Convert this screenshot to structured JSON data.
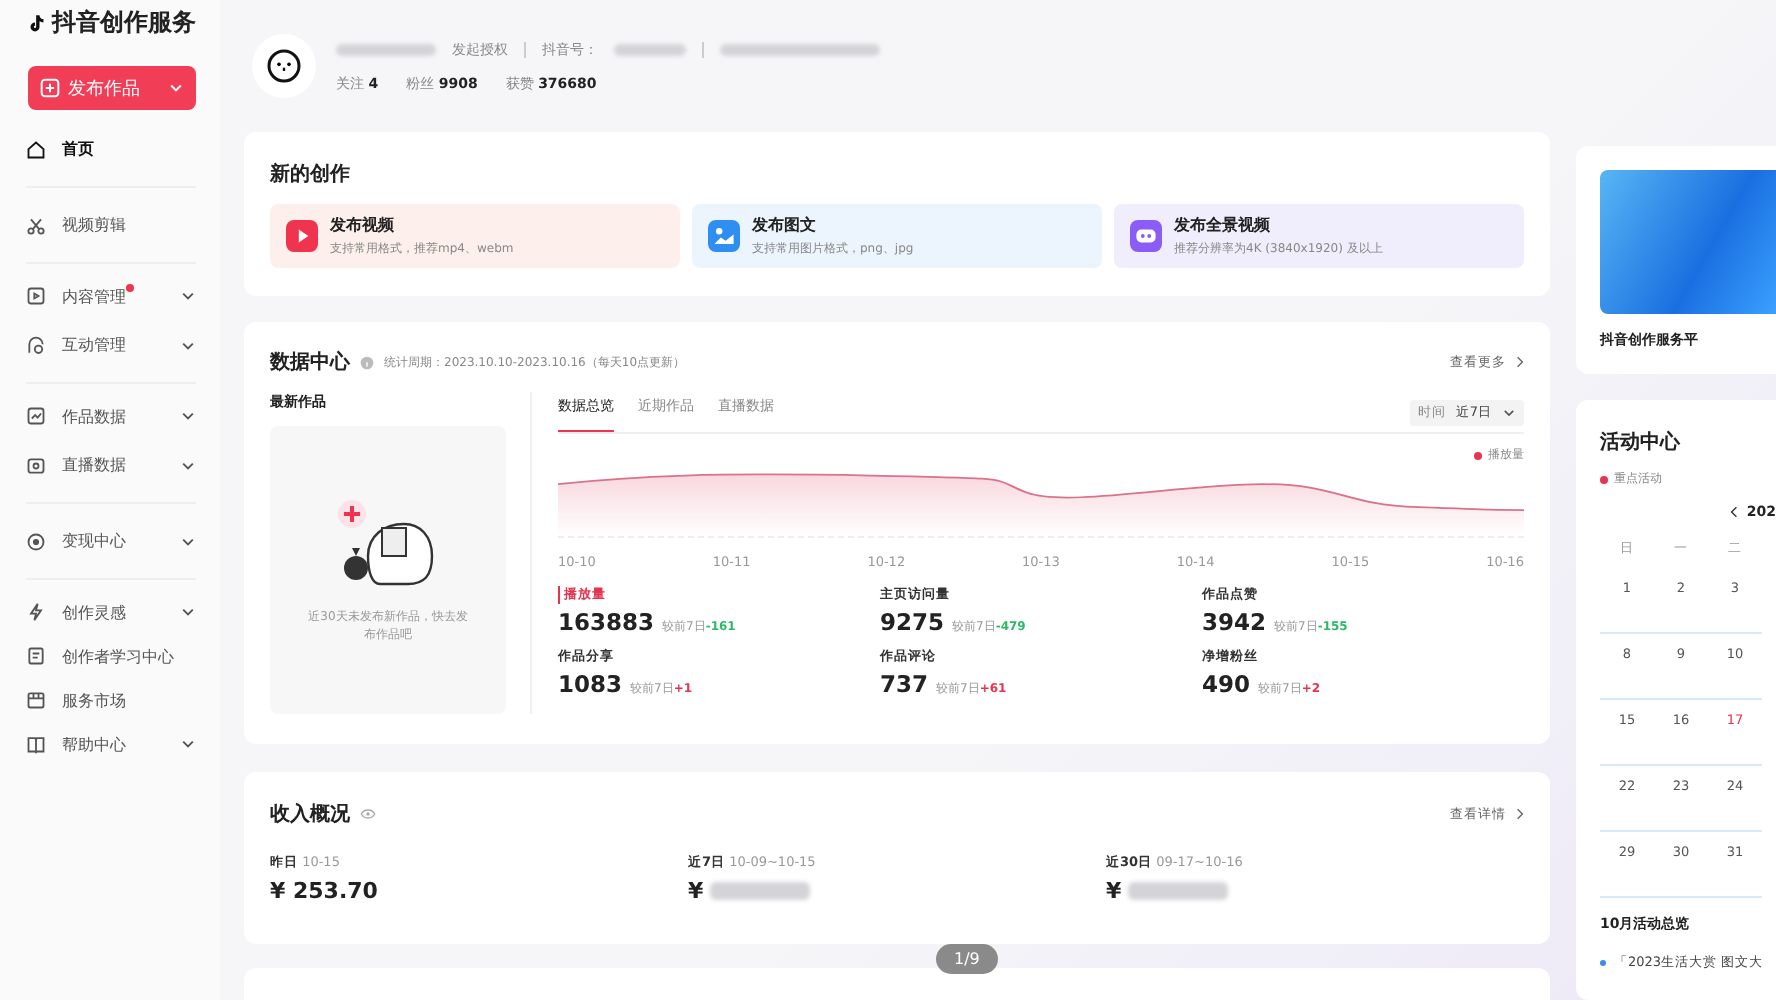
{
  "brand": {
    "name": "抖音创作服务"
  },
  "sidebar": {
    "publish_button": "发布作品",
    "items": [
      {
        "label": "首页",
        "selected": true,
        "expandable": false,
        "dot": false,
        "divider_after": true
      },
      {
        "label": "视频剪辑",
        "selected": false,
        "expandable": false,
        "dot": false,
        "divider_after": true
      },
      {
        "label": "内容管理",
        "selected": false,
        "expandable": true,
        "dot": true,
        "divider_after": false
      },
      {
        "label": "互动管理",
        "selected": false,
        "expandable": true,
        "dot": false,
        "divider_after": true
      },
      {
        "label": "作品数据",
        "selected": false,
        "expandable": true,
        "dot": false,
        "divider_after": false
      },
      {
        "label": "直播数据",
        "selected": false,
        "expandable": true,
        "dot": false,
        "divider_after": true
      },
      {
        "label": "变现中心",
        "selected": false,
        "expandable": true,
        "dot": false,
        "divider_after": true
      },
      {
        "label": "创作灵感",
        "selected": false,
        "expandable": true,
        "dot": false,
        "divider_after": false
      },
      {
        "label": "创作者学习中心",
        "selected": false,
        "expandable": false,
        "dot": false,
        "divider_after": false
      },
      {
        "label": "服务市场",
        "selected": false,
        "expandable": false,
        "dot": false,
        "divider_after": false
      },
      {
        "label": "帮助中心",
        "selected": false,
        "expandable": true,
        "dot": false,
        "divider_after": false
      }
    ]
  },
  "profile": {
    "authorize_link": "发起授权",
    "id_label": "抖音号：",
    "stats": [
      {
        "label": "关注",
        "value": "4"
      },
      {
        "label": "粉丝",
        "value": "9908"
      },
      {
        "label": "获赞",
        "value": "376680"
      }
    ]
  },
  "new_creation": {
    "title": "新的创作",
    "cards": [
      {
        "kind": "video",
        "title": "发布视频",
        "desc": "支持常用格式，推荐mp4、webm"
      },
      {
        "kind": "image",
        "title": "发布图文",
        "desc": "支持常用图片格式，png、jpg"
      },
      {
        "kind": "panorama",
        "title": "发布全景视频",
        "desc": "推荐分辨率为4K (3840x1920) 及以上"
      }
    ]
  },
  "data_center": {
    "title": "数据中心",
    "period": "统计周期：2023.10.10-2023.10.16（每天10点更新）",
    "more": "查看更多",
    "latest_title": "最新作品",
    "empty_text": "近30天未发布新作品，快去发布作品吧",
    "tabs": [
      {
        "label": "数据总览",
        "selected": true
      },
      {
        "label": "近期作品",
        "selected": false
      },
      {
        "label": "直播数据",
        "selected": false
      }
    ],
    "time_filter": {
      "label": "时间",
      "value": "近7日"
    },
    "legend": "播放量",
    "x_labels": [
      "10-10",
      "10-11",
      "10-12",
      "10-13",
      "10-14",
      "10-15",
      "10-16"
    ],
    "stats": [
      {
        "label": "播放量",
        "selected": true,
        "value": "163883",
        "compare": "较前7日",
        "delta": "-161",
        "color": "#2eb86a"
      },
      {
        "label": "主页访问量",
        "selected": false,
        "value": "9275",
        "compare": "较前7日",
        "delta": "-479",
        "color": "#2eb86a"
      },
      {
        "label": "作品点赞",
        "selected": false,
        "value": "3942",
        "compare": "较前7日",
        "delta": "-155",
        "color": "#2eb86a"
      },
      {
        "label": "作品分享",
        "selected": false,
        "value": "1083",
        "compare": "较前7日",
        "delta": "+1",
        "color": "#e5344f"
      },
      {
        "label": "作品评论",
        "selected": false,
        "value": "737",
        "compare": "较前7日",
        "delta": "+61",
        "color": "#e5344f"
      },
      {
        "label": "净增粉丝",
        "selected": false,
        "value": "490",
        "compare": "较前7日",
        "delta": "+2",
        "color": "#e5344f"
      }
    ]
  },
  "income": {
    "title": "收入概况",
    "details": "查看详情",
    "items": [
      {
        "label": "昨日",
        "range": "10-15",
        "amount": "¥ 253.70",
        "redacted": false
      },
      {
        "label": "近7日",
        "range": "10-09~10-15",
        "amount": "¥",
        "redacted": true
      },
      {
        "label": "近30日",
        "range": "09-17~10-16",
        "amount": "¥",
        "redacted": true
      }
    ]
  },
  "page_indicator": "1/9",
  "promo": {
    "caption": "抖音创作服务平"
  },
  "activity": {
    "title": "活动中心",
    "legend": "重点活动",
    "month": "202",
    "weekdays": [
      "日",
      "一",
      "二"
    ],
    "weeks": [
      [
        {
          "day": "1",
          "today": false
        },
        {
          "day": "2",
          "today": false
        },
        {
          "day": "3",
          "today": false
        }
      ],
      [
        {
          "day": "8",
          "today": false
        },
        {
          "day": "9",
          "today": false
        },
        {
          "day": "10",
          "today": false
        }
      ],
      [
        {
          "day": "15",
          "today": false
        },
        {
          "day": "16",
          "today": false
        },
        {
          "day": "17",
          "today": true
        }
      ],
      [
        {
          "day": "22",
          "today": false
        },
        {
          "day": "23",
          "today": false
        },
        {
          "day": "24",
          "today": false
        }
      ],
      [
        {
          "day": "29",
          "today": false
        },
        {
          "day": "30",
          "today": false
        },
        {
          "day": "31",
          "today": false
        }
      ]
    ],
    "overview_title": "10月活动总览",
    "events": [
      "「2023生活大赏 图文大"
    ]
  }
}
